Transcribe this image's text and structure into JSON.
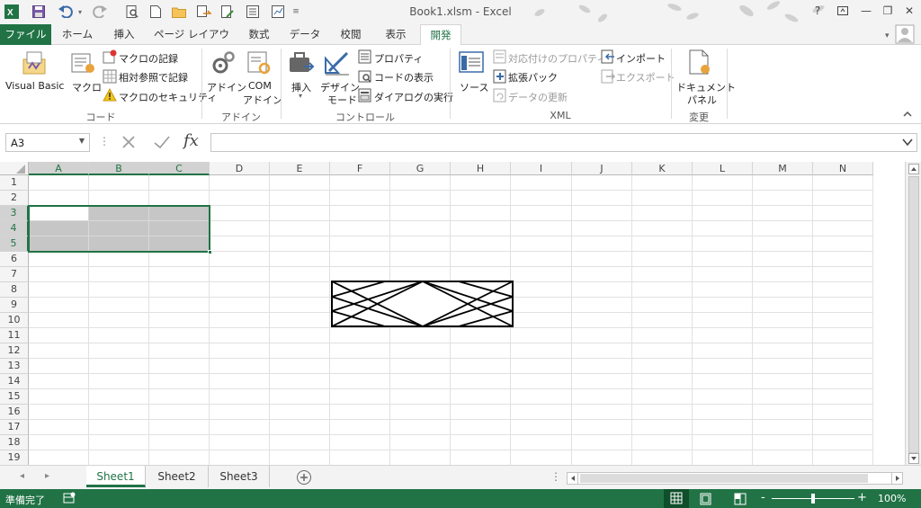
{
  "window": {
    "title": "Book1.xlsm - Excel"
  },
  "icons": {
    "excel": "excel-logo-icon",
    "save": "save-icon",
    "undo": "undo-icon",
    "redo": "redo-icon",
    "help": "help-icon",
    "minimize": "minimize-icon",
    "restore": "restore-icon",
    "close": "close-icon"
  },
  "window_controls": {
    "help": "?",
    "minimize": "—",
    "restore": "❐",
    "close": "✕"
  },
  "tabs": [
    {
      "label": "ファイル"
    },
    {
      "label": "ホーム"
    },
    {
      "label": "挿入"
    },
    {
      "label": "ページ レイアウト"
    },
    {
      "label": "数式"
    },
    {
      "label": "データ"
    },
    {
      "label": "校閲"
    },
    {
      "label": "表示"
    },
    {
      "label": "開発"
    }
  ],
  "ribbon": {
    "code": {
      "group": "コード",
      "vb": "Visual Basic",
      "macro": "マクロ",
      "record": "マクロの記録",
      "relative": "相対参照で記録",
      "security": "マクロのセキュリティ"
    },
    "addin": {
      "group": "アドイン",
      "addin": "アドイン",
      "com1": "COM",
      "com2": "アドイン"
    },
    "controls": {
      "group": "コントロール",
      "insert": "挿入",
      "design1": "デザイン",
      "design2": "モード",
      "properties": "プロパティ",
      "viewcode": "コードの表示",
      "dialog": "ダイアログの実行"
    },
    "xml": {
      "group": "XML",
      "source": "ソース",
      "map": "対応付けのプロパティ",
      "pack": "拡張パック",
      "refresh": "データの更新",
      "import": "インポート",
      "export": "エクスポート"
    },
    "modify": {
      "group": "変更",
      "panel1": "ドキュメント",
      "panel2": "パネル"
    }
  },
  "formula": {
    "namebox": "A3",
    "value": ""
  },
  "columns": [
    "A",
    "B",
    "C",
    "D",
    "E",
    "F",
    "G",
    "H",
    "I",
    "J",
    "K",
    "L",
    "M",
    "N"
  ],
  "rows": [
    "1",
    "2",
    "3",
    "4",
    "5",
    "6",
    "7",
    "8",
    "9",
    "10",
    "11",
    "12",
    "13",
    "14",
    "15",
    "16",
    "17",
    "18",
    "19"
  ],
  "selection": {
    "range": "A3:C5",
    "active": "A3"
  },
  "sheets": [
    {
      "name": "Sheet1",
      "active": true
    },
    {
      "name": "Sheet2",
      "active": false
    },
    {
      "name": "Sheet3",
      "active": false
    }
  ],
  "status": {
    "ready": "準備完了",
    "zoom": "100%"
  },
  "accent": "#217346"
}
